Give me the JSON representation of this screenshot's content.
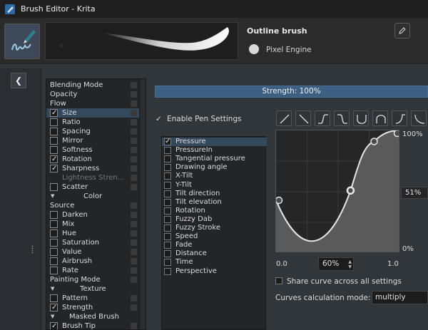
{
  "window": {
    "title": "Brush Editor - Krita"
  },
  "preset": {
    "name": "Outline brush",
    "engine": "Pixel Engine"
  },
  "options": [
    {
      "label": "Blending Mode",
      "kind": "header"
    },
    {
      "label": "Opacity",
      "kind": "header"
    },
    {
      "label": "Flow",
      "kind": "header"
    },
    {
      "label": "Size",
      "kind": "check",
      "checked": true,
      "selected": true
    },
    {
      "label": "Ratio",
      "kind": "check",
      "checked": false
    },
    {
      "label": "Spacing",
      "kind": "check",
      "checked": false
    },
    {
      "label": "Mirror",
      "kind": "check",
      "checked": false
    },
    {
      "label": "Softness",
      "kind": "check",
      "checked": false
    },
    {
      "label": "Rotation",
      "kind": "check",
      "checked": true
    },
    {
      "label": "Sharpness",
      "kind": "check",
      "checked": true
    },
    {
      "label": "Lightness Stren...",
      "kind": "dim"
    },
    {
      "label": "Scatter",
      "kind": "check",
      "checked": false
    },
    {
      "label": "Color",
      "kind": "group"
    },
    {
      "label": "Source",
      "kind": "header"
    },
    {
      "label": "Darken",
      "kind": "check",
      "checked": false
    },
    {
      "label": "Mix",
      "kind": "check",
      "checked": false
    },
    {
      "label": "Hue",
      "kind": "check",
      "checked": false
    },
    {
      "label": "Saturation",
      "kind": "check",
      "checked": false
    },
    {
      "label": "Value",
      "kind": "check",
      "checked": false
    },
    {
      "label": "Airbrush",
      "kind": "check",
      "checked": false
    },
    {
      "label": "Rate",
      "kind": "check",
      "checked": false
    },
    {
      "label": "Painting Mode",
      "kind": "header"
    },
    {
      "label": "Texture",
      "kind": "group"
    },
    {
      "label": "Pattern",
      "kind": "check",
      "checked": false
    },
    {
      "label": "Strength",
      "kind": "check",
      "checked": true
    },
    {
      "label": "Masked Brush",
      "kind": "group"
    },
    {
      "label": "Brush Tip",
      "kind": "check",
      "checked": true
    }
  ],
  "strength": {
    "label": "Strength: 100%",
    "value": 1.0
  },
  "enable_pen": {
    "label": "Enable Pen Settings",
    "checked": true
  },
  "curve_presets": [
    "linear",
    "reverse-linear",
    "s-curve",
    "reverse-s-curve",
    "u-curve",
    "arch-curve",
    "j-curve",
    "reverse-j-curve"
  ],
  "sensors": [
    {
      "label": "Pressure",
      "checked": true,
      "selected": true
    },
    {
      "label": "PressureIn",
      "checked": false
    },
    {
      "label": "Tangential pressure",
      "checked": false
    },
    {
      "label": "Drawing angle",
      "checked": false
    },
    {
      "label": "X-Tilt",
      "checked": false
    },
    {
      "label": "Y-Tilt",
      "checked": false
    },
    {
      "label": "Tilt direction",
      "checked": false
    },
    {
      "label": "Tilt elevation",
      "checked": false
    },
    {
      "label": "Rotation",
      "checked": false
    },
    {
      "label": "Fuzzy Dab",
      "checked": false
    },
    {
      "label": "Fuzzy Stroke",
      "checked": false
    },
    {
      "label": "Speed",
      "checked": false
    },
    {
      "label": "Fade",
      "checked": false
    },
    {
      "label": "Distance",
      "checked": false
    },
    {
      "label": "Time",
      "checked": false
    },
    {
      "label": "Perspective",
      "checked": false
    }
  ],
  "curve": {
    "y_top": "100%",
    "y_mid": "51%",
    "y_bottom": "0%",
    "x_min": "0.0",
    "x_max": "1.0",
    "input_value": "60%",
    "side_value": "51%",
    "points": [
      [
        0.0,
        0.43
      ],
      [
        0.6,
        0.51
      ],
      [
        0.79,
        0.91
      ],
      [
        1.0,
        1.0
      ]
    ]
  },
  "share": {
    "label": "Share curve across all settings",
    "checked": false
  },
  "calc_mode": {
    "label": "Curves calculation mode:",
    "value": "multiply"
  },
  "colors": {
    "accent": "#3c5f82",
    "selection": "#35495e",
    "bg": "#31363b"
  }
}
